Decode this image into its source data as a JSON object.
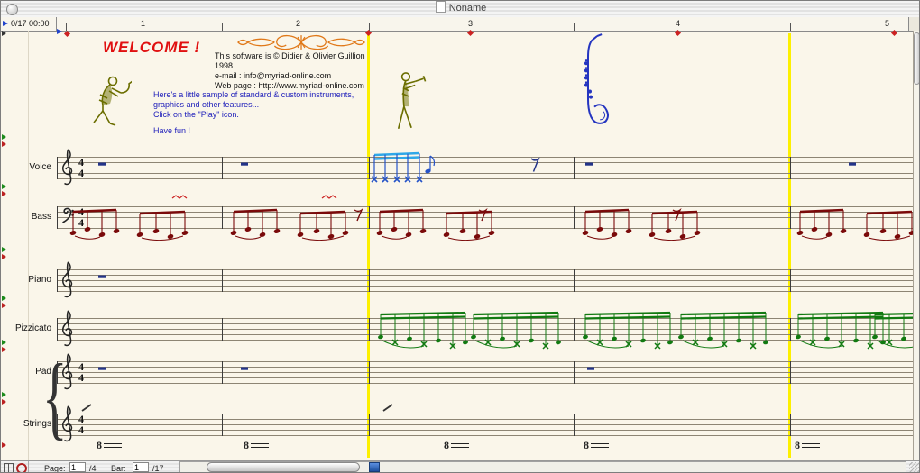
{
  "window": {
    "title": "Noname"
  },
  "transport": {
    "time_display": "0/17 00:00"
  },
  "ruler": {
    "bars": [
      "1",
      "2",
      "3",
      "4",
      "5"
    ]
  },
  "welcome": {
    "headline": "WELCOME !",
    "credit1": "This software is © Didier & Olivier Guillion",
    "credit2": "1998",
    "credit3": "e-mail : info@myriad-online.com",
    "credit4": "Web page : http://www.myriad-online.com",
    "info1": "Here's a little sample of standard & custom instruments,",
    "info2": "graphics and other features...",
    "info3": "Click on the \"Play\" icon.",
    "info4": "Have fun !"
  },
  "staves": [
    {
      "label": "Voice"
    },
    {
      "label": "Bass"
    },
    {
      "label": "Piano"
    },
    {
      "label": "Pizzicato"
    },
    {
      "label": "Pad"
    },
    {
      "label": "Strings"
    }
  ],
  "score": {
    "time_sig_top": "4",
    "time_sig_bottom": "4",
    "ottava": "8"
  },
  "statusbar": {
    "page_label": "Page:",
    "page_value": "1",
    "page_total": "/4",
    "bar_label": "Bar:",
    "bar_value": "1",
    "bar_total": "/17"
  },
  "colors": {
    "selection_yellow": "#fdf000",
    "bass_note": "#7a0a0a",
    "voice_note": "#2553c8",
    "voice_beam": "#2fa8e8",
    "pizzicato_note": "#117a11",
    "welcome_red": "#e01010",
    "info_blue": "#2222bb",
    "ornament_orange": "#e07818",
    "figure_olive": "#6b6e00",
    "sax_blue": "#2535c0"
  }
}
